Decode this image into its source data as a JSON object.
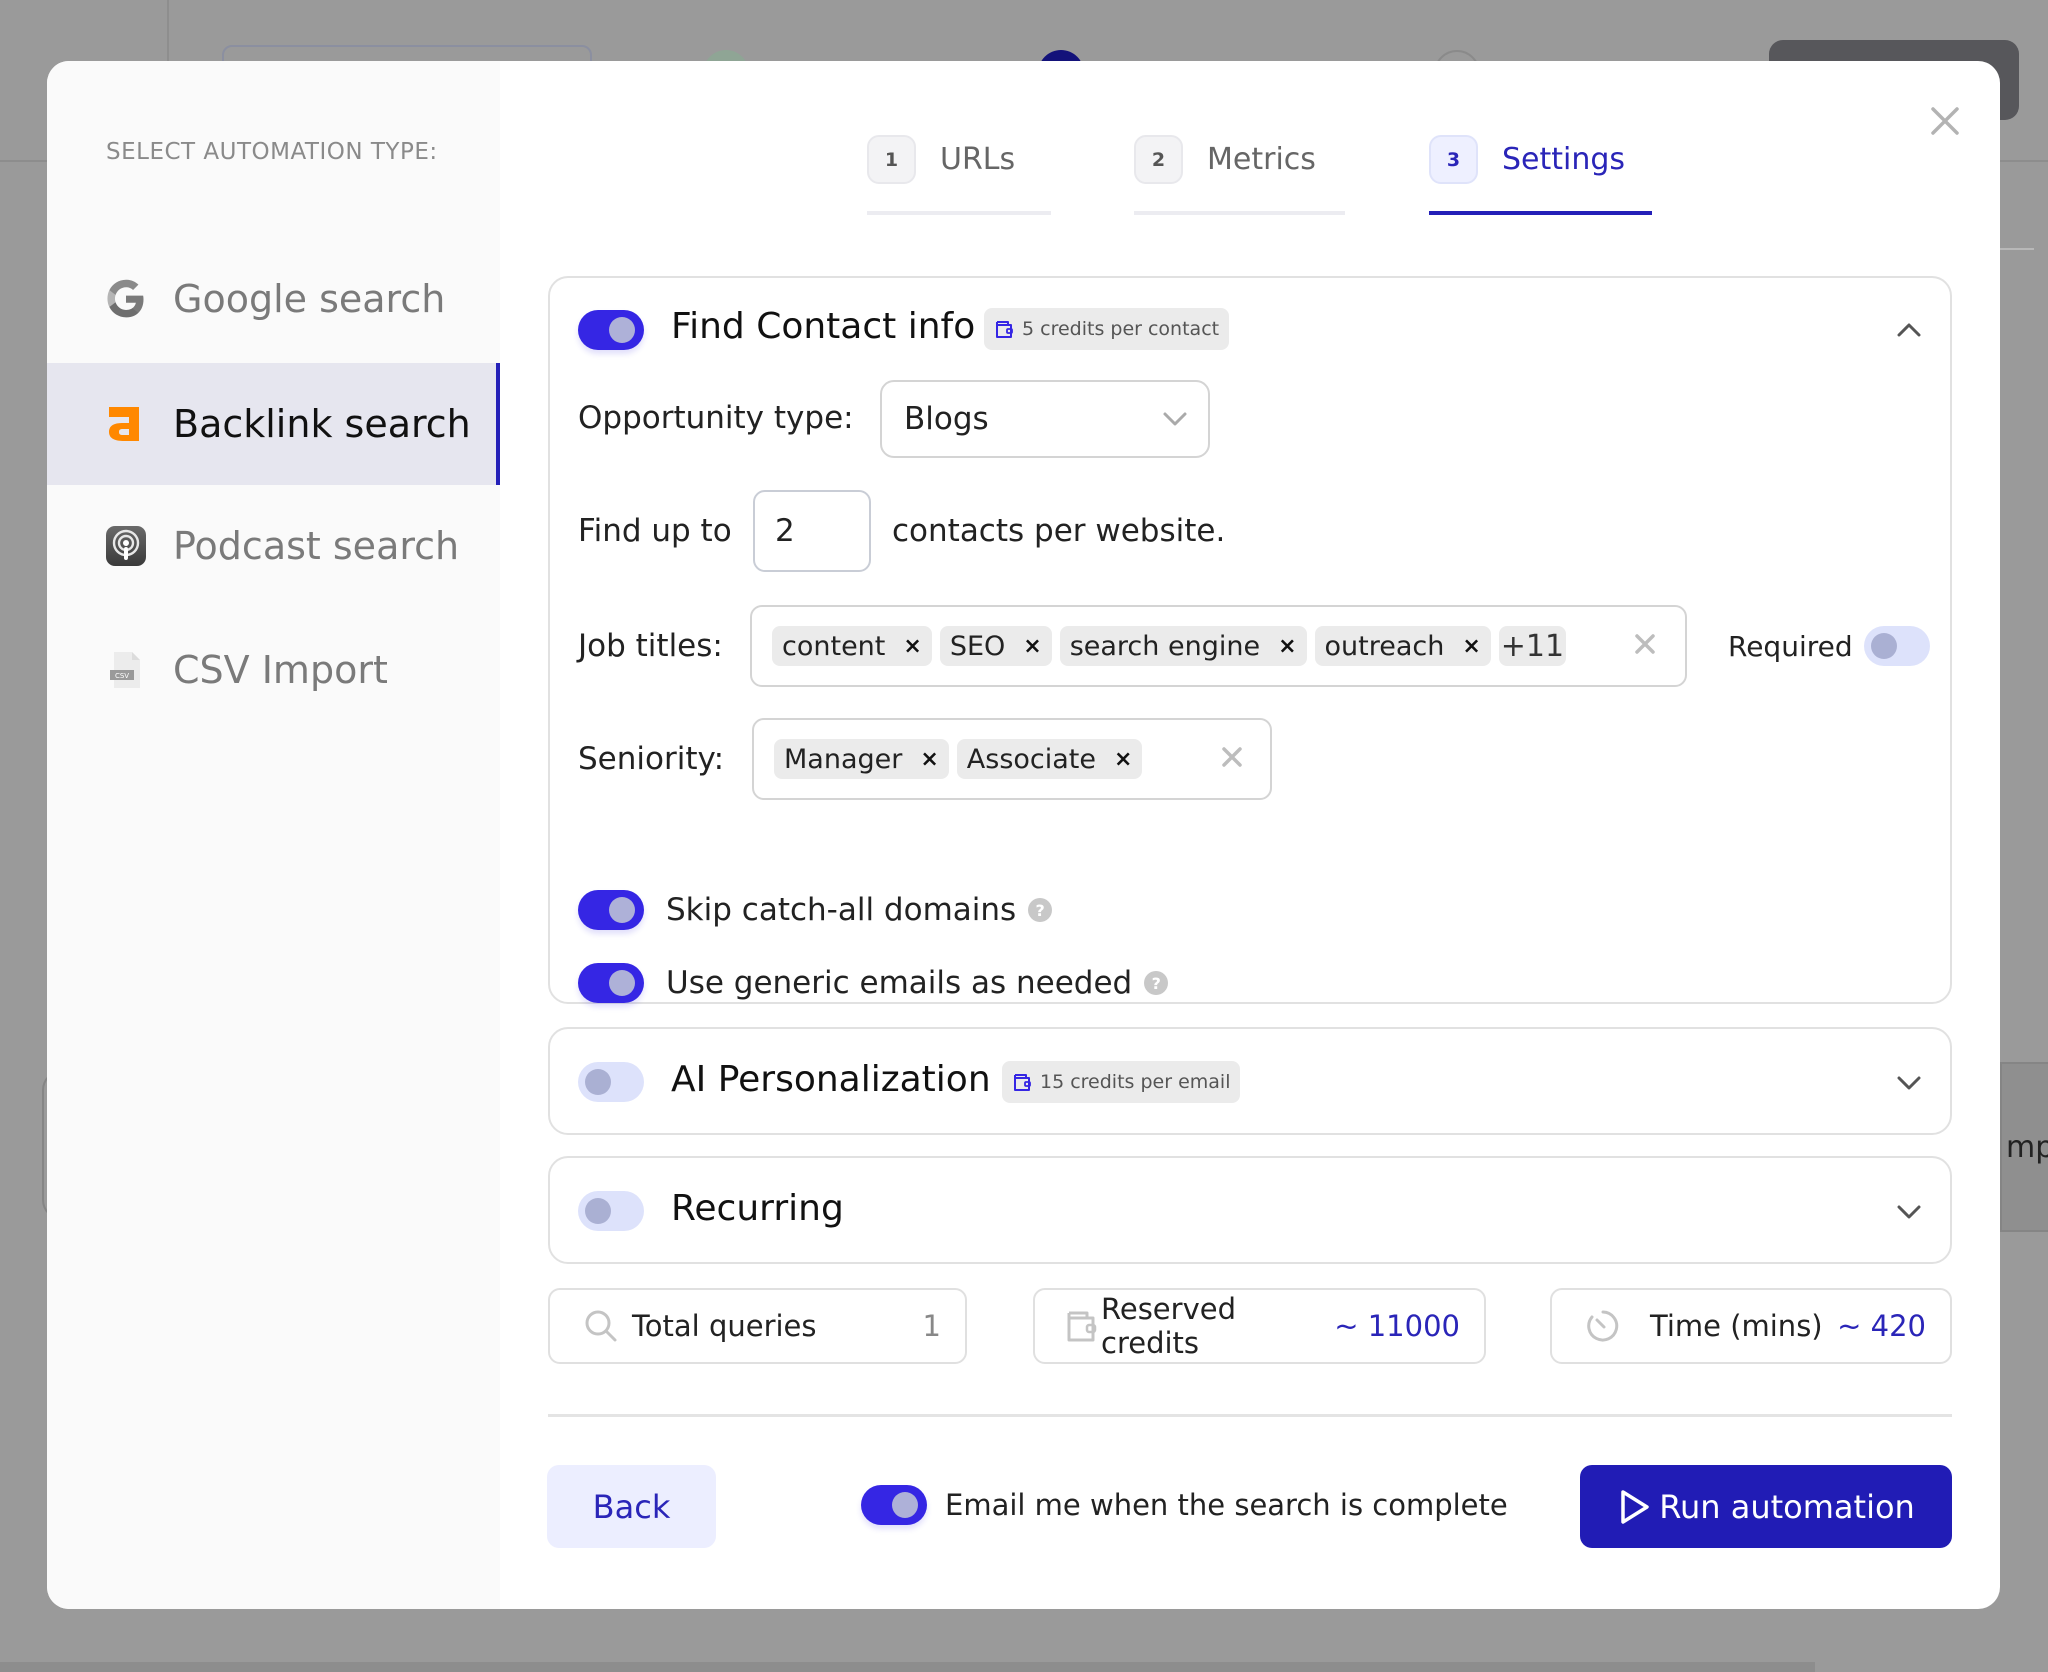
{
  "sidebar": {
    "title": "SELECT AUTOMATION TYPE:",
    "items": [
      {
        "label": "Google search",
        "icon": "google-icon",
        "active": false
      },
      {
        "label": "Backlink search",
        "icon": "ahrefs-icon",
        "active": true
      },
      {
        "label": "Podcast search",
        "icon": "podcast-icon",
        "active": false
      },
      {
        "label": "CSV Import",
        "icon": "csv-file-icon",
        "active": false
      }
    ]
  },
  "steps": [
    {
      "number": "1",
      "label": "URLs",
      "active": false
    },
    {
      "number": "2",
      "label": "Metrics",
      "active": false
    },
    {
      "number": "3",
      "label": "Settings",
      "active": true
    }
  ],
  "contact": {
    "title": "Find Contact info",
    "enabled": true,
    "credits": "5 credits per contact",
    "opportunity_label": "Opportunity type:",
    "opportunity_value": "Blogs",
    "find_prefix": "Find up to",
    "find_value": "2",
    "find_suffix": "contacts per website.",
    "job_titles_label": "Job titles:",
    "job_titles": [
      "content",
      "SEO",
      "search engine",
      "outreach"
    ],
    "job_titles_more": "+11",
    "required_label": "Required",
    "required_enabled": false,
    "seniority_label": "Seniority:",
    "seniority": [
      "Manager",
      "Associate"
    ],
    "skip_catchall_label": "Skip catch-all domains",
    "skip_catchall_enabled": true,
    "generic_emails_label": "Use generic emails as needed",
    "generic_emails_enabled": true
  },
  "ai": {
    "title": "AI Personalization",
    "enabled": false,
    "credits": "15 credits per email"
  },
  "recurring": {
    "title": "Recurring",
    "enabled": false
  },
  "stats": {
    "queries_label": "Total queries",
    "queries_value": "1",
    "credits_label": "Reserved credits",
    "credits_value": "~ 11000",
    "time_label": "Time (mins)",
    "time_value": "~ 420"
  },
  "footer": {
    "back_label": "Back",
    "email_label": "Email me when the search is complete",
    "email_enabled": true,
    "run_label": "Run automation"
  },
  "background": {
    "partial_text": "mpo"
  },
  "colors": {
    "accent": "#2420b8",
    "toggle_on": "#3526e4",
    "ahrefs_orange": "#ff8800"
  }
}
